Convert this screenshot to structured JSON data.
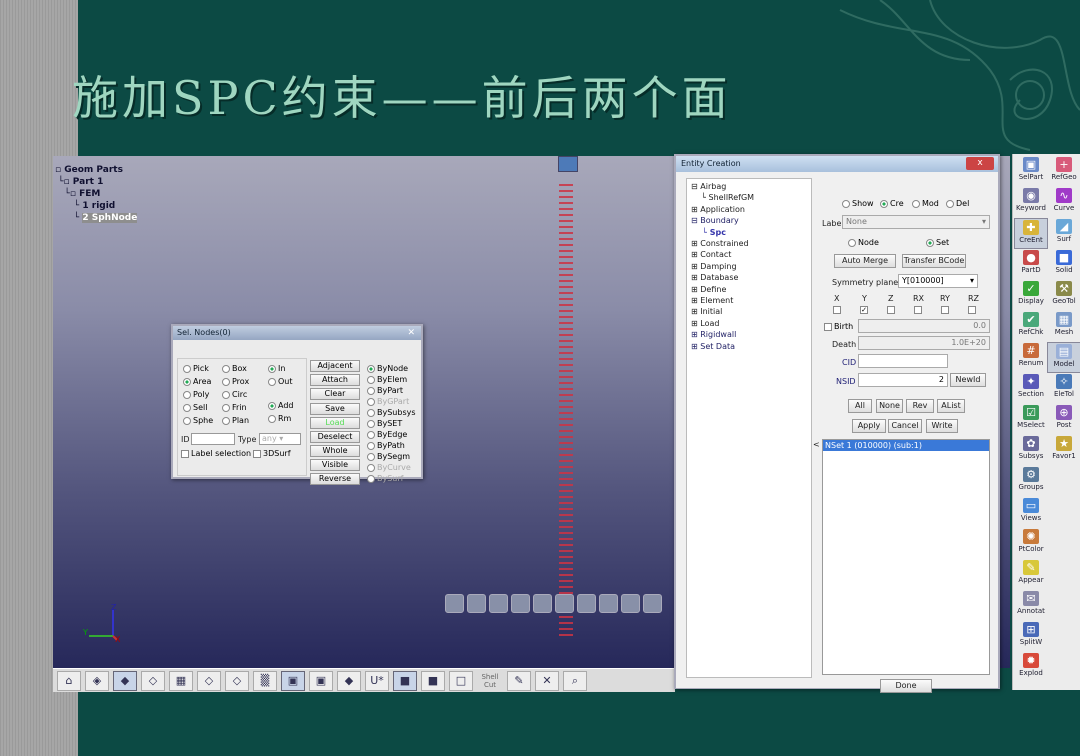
{
  "slide_title": "施加SPC约束——前后两个面",
  "part_tree": {
    "root": "Geom Parts",
    "part": "Part 1",
    "group": "FEM",
    "children": [
      "1 rigid",
      "2 SphNode"
    ],
    "selected": "2 SphNode"
  },
  "sel_nodes": {
    "title": "Sel. Nodes(0)",
    "col1": [
      "Pick",
      "Area",
      "Poly",
      "Sell",
      "Sphe"
    ],
    "col2": [
      "Box",
      "Prox",
      "Circ",
      "Frin",
      "Plan"
    ],
    "col3a": [
      "In",
      "Out"
    ],
    "col3b": [
      "Add",
      "Rm"
    ],
    "id_label": "ID",
    "type_label": "Type",
    "type_value": "any",
    "label_selection": "Label selection",
    "surf3d": "3DSurf",
    "buttons": [
      "Adjacent",
      "Attach",
      "Clear",
      "Save",
      "Load",
      "Deselect",
      "Whole",
      "Visible",
      "Reverse"
    ],
    "modes": [
      "ByNode",
      "ByElem",
      "ByPart",
      "ByGPart",
      "BySubsys",
      "BySET",
      "ByEdge",
      "ByPath",
      "BySegm",
      "ByCurve",
      "BySurf"
    ]
  },
  "entity_creation": {
    "title": "Entity Creation",
    "close": "x",
    "tree": [
      {
        "label": "Airbag",
        "style": "b"
      },
      {
        "label": "ShellRefGM",
        "style": "b"
      },
      {
        "label": "Application",
        "style": "b"
      },
      {
        "label": "Boundary",
        "style": "b"
      },
      {
        "label": "Spc",
        "style": "s"
      },
      {
        "label": "Constrained",
        "style": "b"
      },
      {
        "label": "Contact",
        "style": "b"
      },
      {
        "label": "Damping",
        "style": "b"
      },
      {
        "label": "Database",
        "style": "b"
      },
      {
        "label": "Define",
        "style": "b"
      },
      {
        "label": "Element",
        "style": "b"
      },
      {
        "label": "Initial",
        "style": "b"
      },
      {
        "label": "Load",
        "style": "b"
      },
      {
        "label": "Rigidwall",
        "style": "b"
      },
      {
        "label": "Set Data",
        "style": "b"
      }
    ],
    "modes": [
      "Show",
      "Cre",
      "Mod",
      "Del"
    ],
    "label_field_label": "Label",
    "label_field_value": "None",
    "node_label": "Node",
    "set_label": "Set",
    "auto_merge": "Auto Merge",
    "transfer_bcode": "Transfer BCode",
    "symmetry_label": "Symmetry plane",
    "symmetry_value": "Y[010000]",
    "dofs": [
      "X",
      "Y",
      "Z",
      "RX",
      "RY",
      "RZ"
    ],
    "birth_label": "Birth",
    "birth_value": "0.0",
    "death_label": "Death",
    "death_value": "1.0E+20",
    "cid_label": "CID",
    "nsid_label": "NSID",
    "nsid_value": "2",
    "newid": "NewId",
    "row1_buttons": [
      "All",
      "None",
      "Rev",
      "AList"
    ],
    "row2_buttons": [
      "Apply",
      "Cancel",
      "Write"
    ],
    "list_marker": "<",
    "list_items": [
      "NSet 1 (010000) (sub:1)"
    ],
    "done": "Done"
  },
  "right_toolbar": [
    [
      "SelPart",
      "RefGeo"
    ],
    [
      "Keyword",
      "Curve"
    ],
    [
      "CreEnt",
      "Surf"
    ],
    [
      "PartD",
      "Solid"
    ],
    [
      "Display",
      "GeoTol"
    ],
    [
      "RefChk",
      "Mesh"
    ],
    [
      "Renum",
      "Model"
    ],
    [
      "Section",
      "EleTol"
    ],
    [
      "MSelect",
      "Post"
    ],
    [
      "Subsys",
      "Favor1"
    ],
    [
      "Groups",
      ""
    ],
    [
      "Views",
      ""
    ],
    [
      "PtColor",
      ""
    ],
    [
      "Appear",
      ""
    ],
    [
      "Annotat",
      ""
    ],
    [
      "SplitW",
      ""
    ],
    [
      "Explod",
      ""
    ]
  ],
  "bottom_toolbar": {
    "shell_cut": "Shell Cut"
  },
  "axis": {
    "z": "Z",
    "y": "Y",
    "x": "X"
  }
}
